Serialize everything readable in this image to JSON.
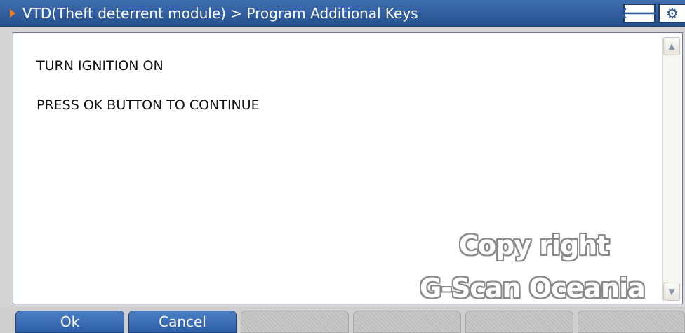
{
  "titlebar": {
    "breadcrumb": "VTD(Theft deterrent module) > Program Additional Keys",
    "back_icon": "back-arrow-icon",
    "back_glyph": "🡐",
    "settings_icon": "gear-icon",
    "settings_glyph": "⚙"
  },
  "content": {
    "line1": "TURN IGNITION ON",
    "line2": "PRESS OK BUTTON TO CONTINUE"
  },
  "scrollbar": {
    "up_glyph": "▲",
    "down_glyph": "▼"
  },
  "watermark": {
    "line1": "Copy right",
    "line2": "G-Scan Oceania"
  },
  "buttons": {
    "ok_label": "Ok",
    "cancel_label": "Cancel"
  },
  "colors": {
    "title_bar": "#27518f",
    "accent_arrow": "#f08020",
    "active_button": "#3a6db4"
  }
}
